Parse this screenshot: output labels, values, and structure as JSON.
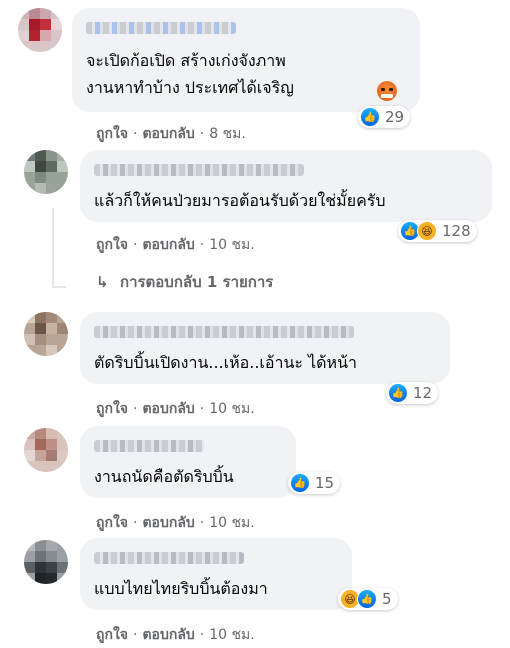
{
  "comments": [
    {
      "text_line1": "จะเปิดก้อเปิด สร้างเก่งจังภาพ",
      "text_line2": "งานหาทำบ้าง ประเทศได้เจริญ",
      "inline_emoji": "angry-face-emoji",
      "like_label": "ถูกใจ",
      "reply_label": "ตอบกลับ",
      "time": "8 ชม.",
      "reactions": [
        "like"
      ],
      "reaction_count": "29"
    },
    {
      "text_line1": "แล้วก็ให้คนป่วยมารอต้อนรับด้วยใช่มั้ยครับ",
      "like_label": "ถูกใจ",
      "reply_label": "ตอบกลับ",
      "time": "10 ชม.",
      "reactions": [
        "like",
        "haha"
      ],
      "reaction_count": "128",
      "view_replies": "การตอบกลับ 1 รายการ"
    },
    {
      "text_line1": "ตัดริบบิ้นเปิดงาน...เห้อ..เอ้านะ ได้หน้า",
      "like_label": "ถูกใจ",
      "reply_label": "ตอบกลับ",
      "time": "10 ชม.",
      "reactions": [
        "like"
      ],
      "reaction_count": "12"
    },
    {
      "text_line1": "งานถนัดคือตัดริบบิ้น",
      "like_label": "ถูกใจ",
      "reply_label": "ตอบกลับ",
      "time": "10 ชม.",
      "reactions": [
        "like"
      ],
      "reaction_count": "15"
    },
    {
      "text_line1": "แบบไทยไทยริบบิ้นต้องมา",
      "like_label": "ถูกใจ",
      "reply_label": "ตอบกลับ",
      "time": "10 ชม.",
      "reactions": [
        "haha",
        "like"
      ],
      "reaction_count": "5"
    }
  ],
  "separator": "·",
  "reply_arrow_icon": "reply-arrow-icon",
  "colors": {
    "bubble": "#f0f2f5",
    "secondary_text": "#65676b",
    "like_blue": "#0165e1",
    "haha_yellow": "#f7b125",
    "angry_orange": "#e9710f"
  }
}
